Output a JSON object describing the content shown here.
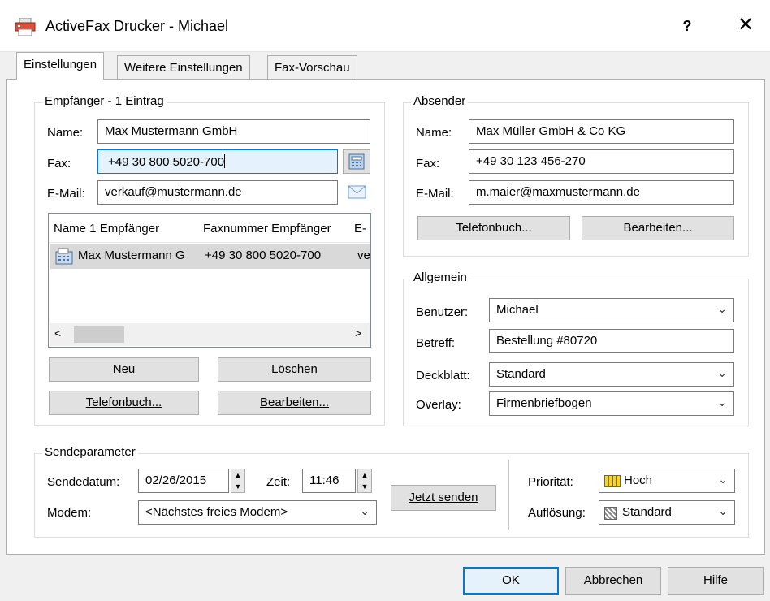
{
  "window": {
    "title": "ActiveFax Drucker - Michael",
    "help_label": "?",
    "close_label": "✕"
  },
  "tabs": [
    {
      "label": "Einstellungen",
      "active": true
    },
    {
      "label": "Weitere Einstellungen",
      "active": false
    },
    {
      "label": "Fax-Vorschau",
      "active": false
    }
  ],
  "recipient": {
    "legend": "Empfänger - 1 Eintrag",
    "name_label": "Name:",
    "name_value": "Max Mustermann GmbH",
    "fax_label": "Fax:",
    "fax_value": "+49 30 800 5020-700",
    "email_label": "E-Mail:",
    "email_value": "verkauf@mustermann.de",
    "list": {
      "headers": [
        "Name 1 Empfänger",
        "Faxnummer Empfänger",
        "E-"
      ],
      "rows": [
        {
          "name": "Max Mustermann G",
          "fax": "+49 30 800 5020-700",
          "email": "ve"
        }
      ]
    },
    "btn_new": "Neu",
    "btn_delete": "Löschen",
    "btn_phonebook": "Telefonbuch...",
    "btn_edit": "Bearbeiten..."
  },
  "sender": {
    "legend": "Absender",
    "name_label": "Name:",
    "name_value": "Max Müller GmbH & Co KG",
    "fax_label": "Fax:",
    "fax_value": "+49 30 123 456-270",
    "email_label": "E-Mail:",
    "email_value": "m.maier@maxmustermann.de",
    "btn_phonebook": "Telefonbuch...",
    "btn_edit": "Bearbeiten..."
  },
  "general": {
    "legend": "Allgemein",
    "user_label": "Benutzer:",
    "user_value": "Michael",
    "subject_label": "Betreff:",
    "subject_value": "Bestellung #80720",
    "cover_label": "Deckblatt:",
    "cover_value": "Standard",
    "overlay_label": "Overlay:",
    "overlay_value": "Firmenbriefbogen"
  },
  "send": {
    "legend": "Sendeparameter",
    "date_label": "Sendedatum:",
    "date_value": "02/26/2015",
    "time_label": "Zeit:",
    "time_value": "11:46",
    "modem_label": "Modem:",
    "modem_value": "<Nächstes freies Modem>",
    "send_now": "Jetzt senden",
    "priority_label": "Priorität:",
    "priority_value": "Hoch",
    "resolution_label": "Auflösung:",
    "resolution_value": "Standard"
  },
  "footer": {
    "ok": "OK",
    "cancel": "Abbrechen",
    "help": "Hilfe"
  },
  "colors": {
    "focus_fill": "#e5f1fb",
    "accent": "#0078d7"
  }
}
